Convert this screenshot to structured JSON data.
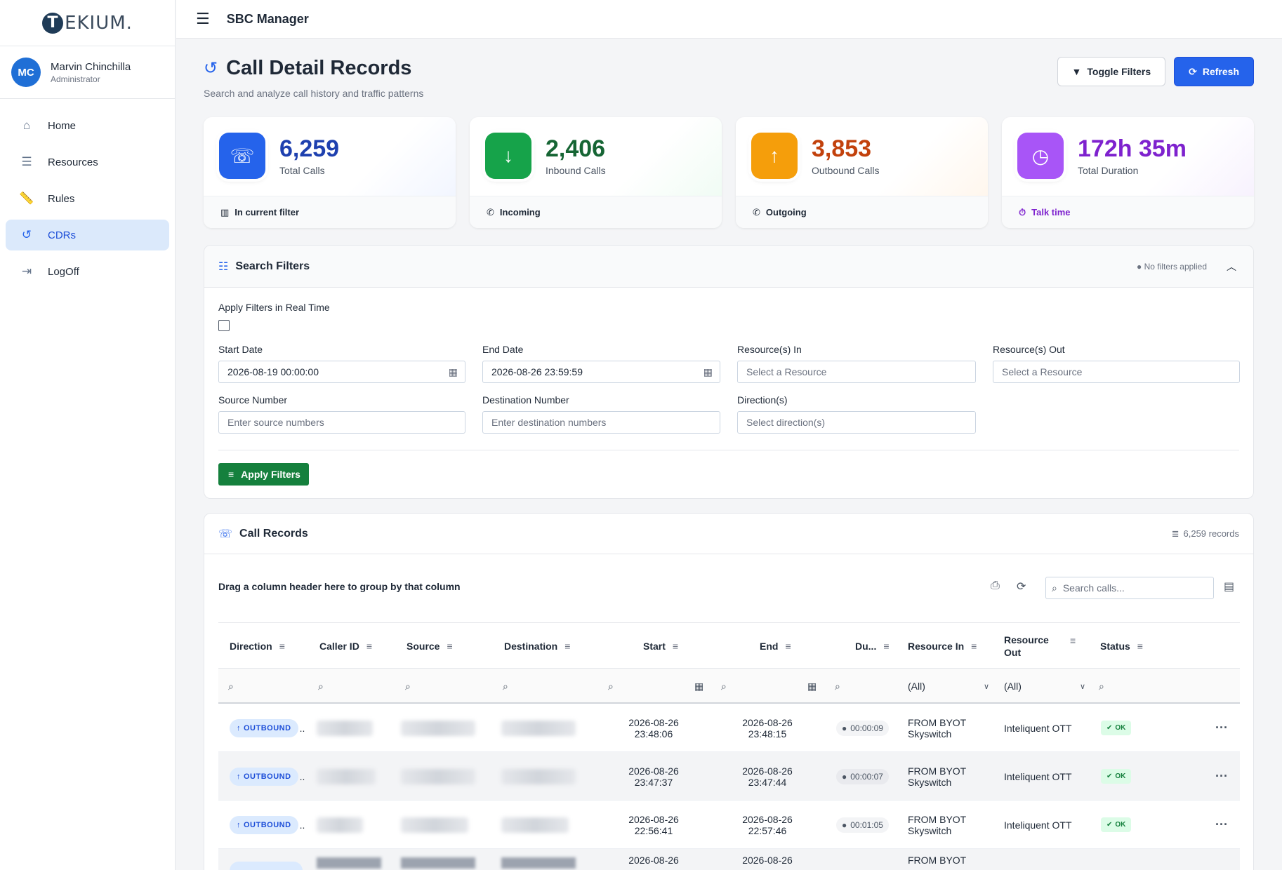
{
  "brand": {
    "logo_letter": "T",
    "logo_text": "EKIUM."
  },
  "user": {
    "initials": "MC",
    "name": "Marvin Chinchilla",
    "role": "Administrator"
  },
  "nav": [
    {
      "label": "Home",
      "icon": "home-icon"
    },
    {
      "label": "Resources",
      "icon": "server-icon"
    },
    {
      "label": "Rules",
      "icon": "ruler-icon"
    },
    {
      "label": "CDRs",
      "icon": "history-icon",
      "active": true
    },
    {
      "label": "LogOff",
      "icon": "logout-icon"
    }
  ],
  "topbar": {
    "title": "SBC Manager"
  },
  "page": {
    "title": "Call Detail Records",
    "subtitle": "Search and analyze call history and traffic patterns",
    "toggle_filters": "Toggle Filters",
    "refresh": "Refresh"
  },
  "stats": [
    {
      "value": "6,259",
      "label": "Total Calls",
      "footer": "In current filter",
      "color": "#1e40af",
      "box": "#2563eb"
    },
    {
      "value": "2,406",
      "label": "Inbound Calls",
      "footer": "Incoming",
      "color": "#166534",
      "box": "#16a34a"
    },
    {
      "value": "3,853",
      "label": "Outbound Calls",
      "footer": "Outgoing",
      "color": "#c2410c",
      "box": "#f59e0b"
    },
    {
      "value": "172h 35m",
      "label": "Total Duration",
      "footer": "Talk time",
      "color": "#7e22ce",
      "box": "#a855f7"
    }
  ],
  "filters": {
    "title": "Search Filters",
    "status": "No filters applied",
    "realtime_label": "Apply Filters in Real Time",
    "start_date_label": "Start Date",
    "start_date": "2026-08-19 00:00:00",
    "end_date_label": "End Date",
    "end_date": "2026-08-26 23:59:59",
    "res_in_label": "Resource(s) In",
    "res_in_ph": "Select a Resource",
    "res_out_label": "Resource(s) Out",
    "res_out_ph": "Select a Resource",
    "source_label": "Source Number",
    "source_ph": "Enter source numbers",
    "dest_label": "Destination Number",
    "dest_ph": "Enter destination numbers",
    "dir_label": "Direction(s)",
    "dir_ph": "Select direction(s)",
    "apply": "Apply Filters"
  },
  "records": {
    "title": "Call Records",
    "count": "6,259 records",
    "group_hint": "Drag a column header here to group by that column",
    "search_ph": "Search calls...",
    "columns": [
      "Direction",
      "Caller ID",
      "Source",
      "Destination",
      "Start",
      "End",
      "Du...",
      "Resource In",
      "Resource Out",
      "Status"
    ],
    "filter_all": "(All)",
    "rows": [
      {
        "direction": "OUTBOUND",
        "start_d": "2026-08-26",
        "start_t": "23:48:06",
        "end_d": "2026-08-26",
        "end_t": "23:48:15",
        "duration": "00:00:09",
        "res_in_1": "FROM BYOT",
        "res_in_2": "Skyswitch",
        "res_out": "Inteliquent OTT",
        "status": "OK"
      },
      {
        "direction": "OUTBOUND",
        "start_d": "2026-08-26",
        "start_t": "23:47:37",
        "end_d": "2026-08-26",
        "end_t": "23:47:44",
        "duration": "00:00:07",
        "res_in_1": "FROM BYOT",
        "res_in_2": "Skyswitch",
        "res_out": "Inteliquent OTT",
        "status": "OK"
      },
      {
        "direction": "OUTBOUND",
        "start_d": "2026-08-26",
        "start_t": "22:56:41",
        "end_d": "2026-08-26",
        "end_t": "22:57:46",
        "duration": "00:01:05",
        "res_in_1": "FROM BYOT",
        "res_in_2": "Skyswitch",
        "res_out": "Inteliquent OTT",
        "status": "OK"
      },
      {
        "direction": "OUTBOUND",
        "start_d": "2026-08-26",
        "start_t": "",
        "end_d": "2026-08-26",
        "end_t": "",
        "duration": "",
        "res_in_1": "FROM BYOT",
        "res_in_2": "",
        "res_out": "",
        "status": ""
      }
    ]
  }
}
